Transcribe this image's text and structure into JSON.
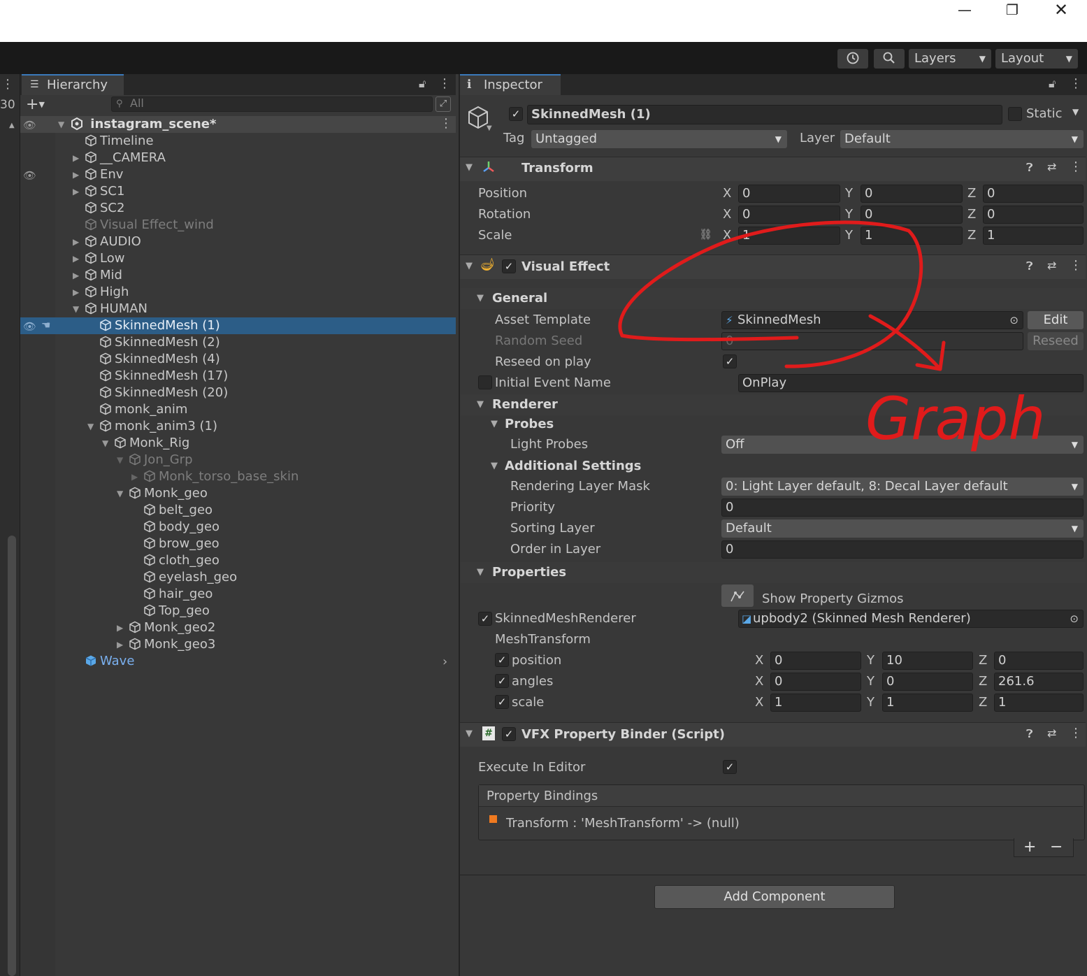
{
  "hierarchy": {
    "tab_label": "Hierarchy",
    "search_placeholder": "All",
    "left_number": "30",
    "items": [
      {
        "label": "instagram_scene*"
      },
      {
        "label": "Timeline"
      },
      {
        "label": "__CAMERA"
      },
      {
        "label": "Env"
      },
      {
        "label": "SC1"
      },
      {
        "label": "SC2"
      },
      {
        "label": "Visual Effect_wind"
      },
      {
        "label": "AUDIO"
      },
      {
        "label": "Low"
      },
      {
        "label": "Mid"
      },
      {
        "label": "High"
      },
      {
        "label": "HUMAN"
      },
      {
        "label": "SkinnedMesh (1)"
      },
      {
        "label": "SkinnedMesh (2)"
      },
      {
        "label": "SkinnedMesh (4)"
      },
      {
        "label": "SkinnedMesh (17)"
      },
      {
        "label": "SkinnedMesh (20)"
      },
      {
        "label": "monk_anim"
      },
      {
        "label": "monk_anim3 (1)"
      },
      {
        "label": "Monk_Rig"
      },
      {
        "label": "Jon_Grp"
      },
      {
        "label": "Monk_torso_base_skin"
      },
      {
        "label": "Monk_geo"
      },
      {
        "label": "belt_geo"
      },
      {
        "label": "body_geo"
      },
      {
        "label": "brow_geo"
      },
      {
        "label": "cloth_geo"
      },
      {
        "label": "eyelash_geo"
      },
      {
        "label": "hair_geo"
      },
      {
        "label": "Top_geo"
      },
      {
        "label": "Monk_geo2"
      },
      {
        "label": "Monk_geo3"
      },
      {
        "label": "Wave"
      }
    ]
  },
  "toolbar": {
    "layers_label": "Layers",
    "layout_label": "Layout"
  },
  "inspector": {
    "tab_label": "Inspector",
    "object_name": "SkinnedMesh (1)",
    "static_label": "Static",
    "tag_label": "Tag",
    "tag_value": "Untagged",
    "layer_label": "Layer",
    "layer_value": "Default",
    "transform": {
      "title": "Transform",
      "position_label": "Position",
      "rotation_label": "Rotation",
      "scale_label": "Scale",
      "position": [
        "0",
        "0",
        "0"
      ],
      "rotation": [
        "0",
        "0",
        "0"
      ],
      "scale": [
        "1",
        "1",
        "1"
      ]
    },
    "axes": {
      "x": "X",
      "y": "Y",
      "z": "Z"
    },
    "visual_effect": {
      "title": "Visual Effect",
      "general": "General",
      "asset_template_label": "Asset Template",
      "asset_template_value": "SkinnedMesh",
      "edit_button": "Edit",
      "random_seed_label": "Random Seed",
      "random_seed_value": "0",
      "reseed_button": "Reseed",
      "reseed_on_play_label": "Reseed on play",
      "initial_event_label": "Initial Event Name",
      "initial_event_value": "OnPlay",
      "renderer": "Renderer",
      "probes": "Probes",
      "light_probes_label": "Light Probes",
      "light_probes_value": "Off",
      "additional_settings": "Additional Settings",
      "rendering_layer_mask_label": "Rendering Layer Mask",
      "rendering_layer_mask_value": "0: Light Layer default, 8: Decal Layer default",
      "priority_label": "Priority",
      "priority_value": "0",
      "sorting_layer_label": "Sorting Layer",
      "sorting_layer_value": "Default",
      "order_in_layer_label": "Order in Layer",
      "order_in_layer_value": "0",
      "properties": "Properties",
      "show_gizmos": "Show Property Gizmos",
      "skinned_renderer_label": "SkinnedMeshRenderer",
      "skinned_renderer_value": "upbody2 (Skinned Mesh Renderer)",
      "mesh_transform_label": "MeshTransform",
      "mt_position_label": "position",
      "mt_angles_label": "angles",
      "mt_scale_label": "scale",
      "mt_position": [
        "0",
        "10",
        "0"
      ],
      "mt_angles": [
        "0",
        "0",
        "261.6"
      ],
      "mt_scale": [
        "1",
        "1",
        "1"
      ]
    },
    "binder": {
      "title": "VFX Property Binder (Script)",
      "execute_label": "Execute In Editor",
      "bindings_header": "Property Bindings",
      "binding_item": "Transform : 'MeshTransform' -> (null)",
      "plus": "+",
      "minus": "−"
    },
    "add_component": "Add Component"
  },
  "annotation": {
    "text": "Graph",
    "color": "#e01b1b"
  }
}
